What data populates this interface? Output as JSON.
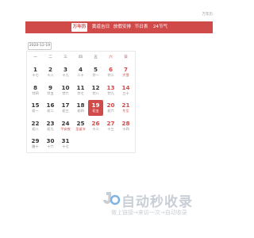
{
  "top_link": "万年历",
  "nav": {
    "tabs": [
      "万年历",
      "黄道吉日",
      "放假安排",
      "节日表",
      "24节气"
    ],
    "active_index": 0
  },
  "date_picker": {
    "value": "2020-12-19"
  },
  "weekdays": [
    "一",
    "二",
    "三",
    "四",
    "五",
    "六",
    "日"
  ],
  "weeks": [
    [
      {
        "day": "1",
        "sub": "十七"
      },
      {
        "day": "2",
        "sub": "十八"
      },
      {
        "day": "3",
        "sub": "十九"
      },
      {
        "day": "4",
        "sub": "二十"
      },
      {
        "day": "5",
        "sub": "廿一"
      },
      {
        "day": "6",
        "sub": "廿二",
        "weekend": true
      },
      {
        "day": "7",
        "sub": "大雪",
        "weekend": true,
        "holiday": true
      }
    ],
    [
      {
        "day": "8",
        "sub": "廿四"
      },
      {
        "day": "9",
        "sub": "廿五"
      },
      {
        "day": "10",
        "sub": "廿六"
      },
      {
        "day": "11",
        "sub": "廿七"
      },
      {
        "day": "12",
        "sub": "廿八"
      },
      {
        "day": "13",
        "sub": "廿九",
        "weekend": true
      },
      {
        "day": "14",
        "sub": "三十",
        "weekend": true
      }
    ],
    [
      {
        "day": "15",
        "sub": "初一"
      },
      {
        "day": "16",
        "sub": "初二"
      },
      {
        "day": "17",
        "sub": "初三"
      },
      {
        "day": "18",
        "sub": "初四"
      },
      {
        "day": "19",
        "sub": "初五",
        "weekend": true,
        "selected": true
      },
      {
        "day": "20",
        "sub": "初六",
        "weekend": true
      },
      {
        "day": "21",
        "sub": "冬至",
        "weekend": true,
        "holiday": true
      }
    ],
    [
      {
        "day": "22",
        "sub": "初八"
      },
      {
        "day": "23",
        "sub": "初九"
      },
      {
        "day": "24",
        "sub": "平安夜",
        "holiday": true
      },
      {
        "day": "25",
        "sub": "圣诞节",
        "holiday": true
      },
      {
        "day": "26",
        "sub": "十二",
        "weekend": true
      },
      {
        "day": "27",
        "sub": "十三",
        "weekend": true
      },
      {
        "day": "28",
        "sub": "十四",
        "weekend": true
      }
    ],
    [
      {
        "day": "29",
        "sub": "腊十"
      },
      {
        "day": "30",
        "sub": "十六"
      },
      {
        "day": "31",
        "sub": "十七"
      },
      null,
      null,
      null,
      null
    ]
  ],
  "watermark": {
    "text": "自动秒收录",
    "subtext": "做上链接→来访一次→自动收录"
  }
}
